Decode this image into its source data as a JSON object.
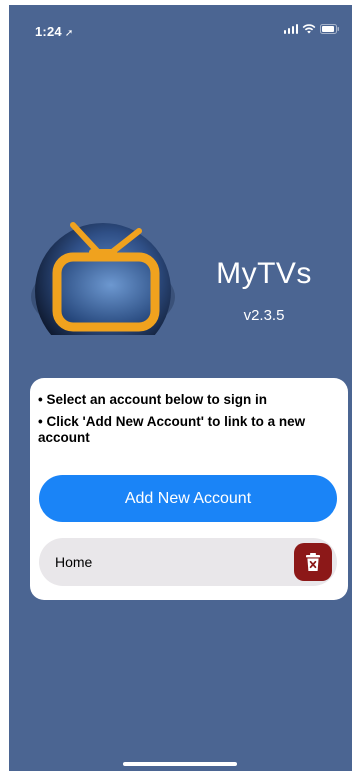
{
  "status_bar": {
    "time": "1:24",
    "location_icon": "location-arrow-icon",
    "signal_icon": "cellular-signal-icon",
    "wifi_icon": "wifi-icon",
    "battery_icon": "battery-icon"
  },
  "app": {
    "logo_icon": "tv-icon",
    "name": "MyTVs",
    "version": "v2.3.5"
  },
  "card": {
    "instructions": [
      "• Select an account below to sign in",
      "• Click 'Add New Account' to link to a new account"
    ],
    "add_button_label": "Add New Account",
    "accounts": [
      {
        "label": "Home",
        "delete_icon": "trash-delete-icon"
      }
    ]
  },
  "colors": {
    "background": "#4b6592",
    "button_blue": "#1a84f7",
    "delete_red": "#8c1818",
    "row_gray": "#e9e7ea",
    "tv_orange": "#f0a21e"
  }
}
